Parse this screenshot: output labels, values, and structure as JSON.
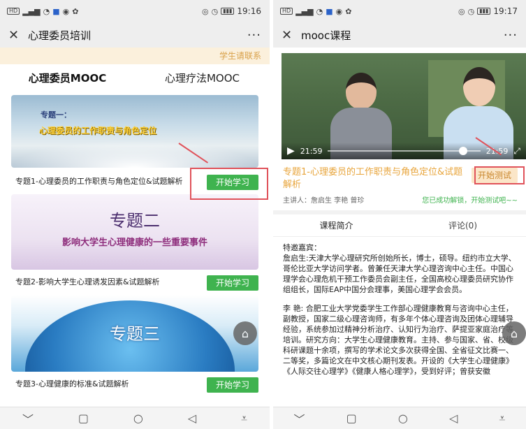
{
  "left": {
    "status": {
      "time": "19:16"
    },
    "nav": {
      "title": "心理委员培训",
      "more": "···"
    },
    "notice": "学生请联系",
    "tabs": [
      "心理委员MOOC",
      "心理疗法MOOC"
    ],
    "courses": [
      {
        "banner_line1": "专题一：",
        "banner_line2": "心理委员的工作职责与角色定位",
        "title": "专题1-心理委员的工作职责与角色定位&试题解析",
        "button": "开始学习"
      },
      {
        "banner_line1": "专题二",
        "banner_line2": "影响大学生心理健康的一些重要事件",
        "title": "专题2-影响大学生心理诱发因素&试题解析",
        "button": "开始学习"
      },
      {
        "banner_line1": "专题三",
        "title": "专题3-心理健康的标准&试题解析",
        "button": "开始学习"
      }
    ]
  },
  "right": {
    "status": {
      "time": "19:17"
    },
    "nav": {
      "title": "mooc课程",
      "more": "···"
    },
    "video": {
      "current": "21:59",
      "duration": "21:59"
    },
    "course": {
      "title": "专题1-心理委员的工作职责与角色定位&试题解析",
      "test_button": "开始测试",
      "speaker": "主讲人：詹启生 李艳 曾珍",
      "unlock_msg": "您已成功解锁，开始测试吧~~"
    },
    "tabs": [
      "课程简介",
      "评论(0)"
    ],
    "description": [
      "特邀嘉宾：",
      "詹启生:天津大学心理研究所创始所长，博士，硕导。纽约市立大学、哥伦比亚大学访问学者。曾兼任天津大学心理咨询中心主任。中国心理学会心理危机干预工作委员会副主任，全国高校心理委员研究协作组组长，国际EAP中国分会理事，美国心理学会会员。",
      "李 艳: 合肥工业大学党委学生工作部心理健康教育与咨询中心主任，副教授，国家二级心理咨询师，有多年个体心理咨询及团体心理辅导经验，系统参加过精神分析治疗、认知行为治疗、萨提亚家庭治疗等培训。研究方向：大学生心理健康教育。主持、参与国家、省、校级科研课题十余项，撰写的学术论文多次获得全国、全省征文比赛一、二等奖，多篇论文在中文核心期刊发表。开设的《大学生心理健康》《人际交往心理学》《健康人格心理学》，受到好评；曾获安徽"
    ]
  }
}
